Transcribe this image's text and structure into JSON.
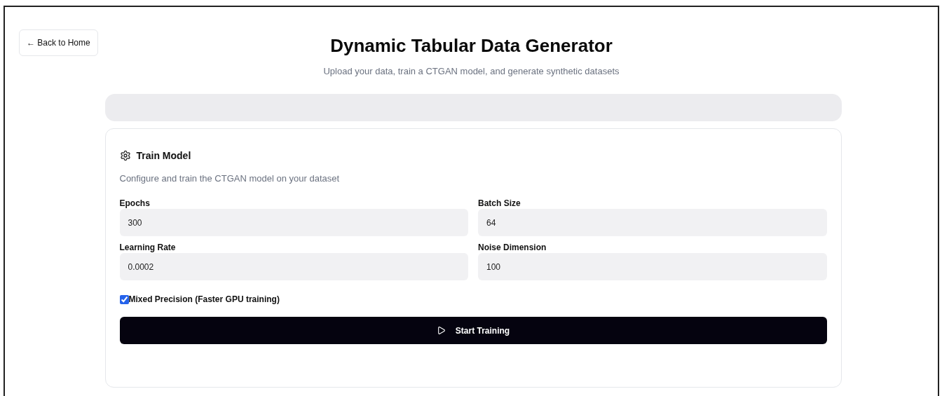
{
  "back_link": "← Back to Home",
  "title": "Dynamic Tabular Data Generator",
  "subtitle": "Upload your data, train a CTGAN model, and generate synthetic datasets",
  "card": {
    "title": "Train Model",
    "description": "Configure and train the CTGAN model on your dataset",
    "fields": [
      {
        "label": "Epochs",
        "value": "300"
      },
      {
        "label": "Batch Size",
        "value": "64"
      },
      {
        "label": "Learning Rate",
        "value": "0.0002"
      },
      {
        "label": "Noise Dimension",
        "value": "100"
      }
    ],
    "checkbox": {
      "label": "Mixed Precision (Faster GPU training)",
      "checked": true
    },
    "button": "Start Training"
  }
}
